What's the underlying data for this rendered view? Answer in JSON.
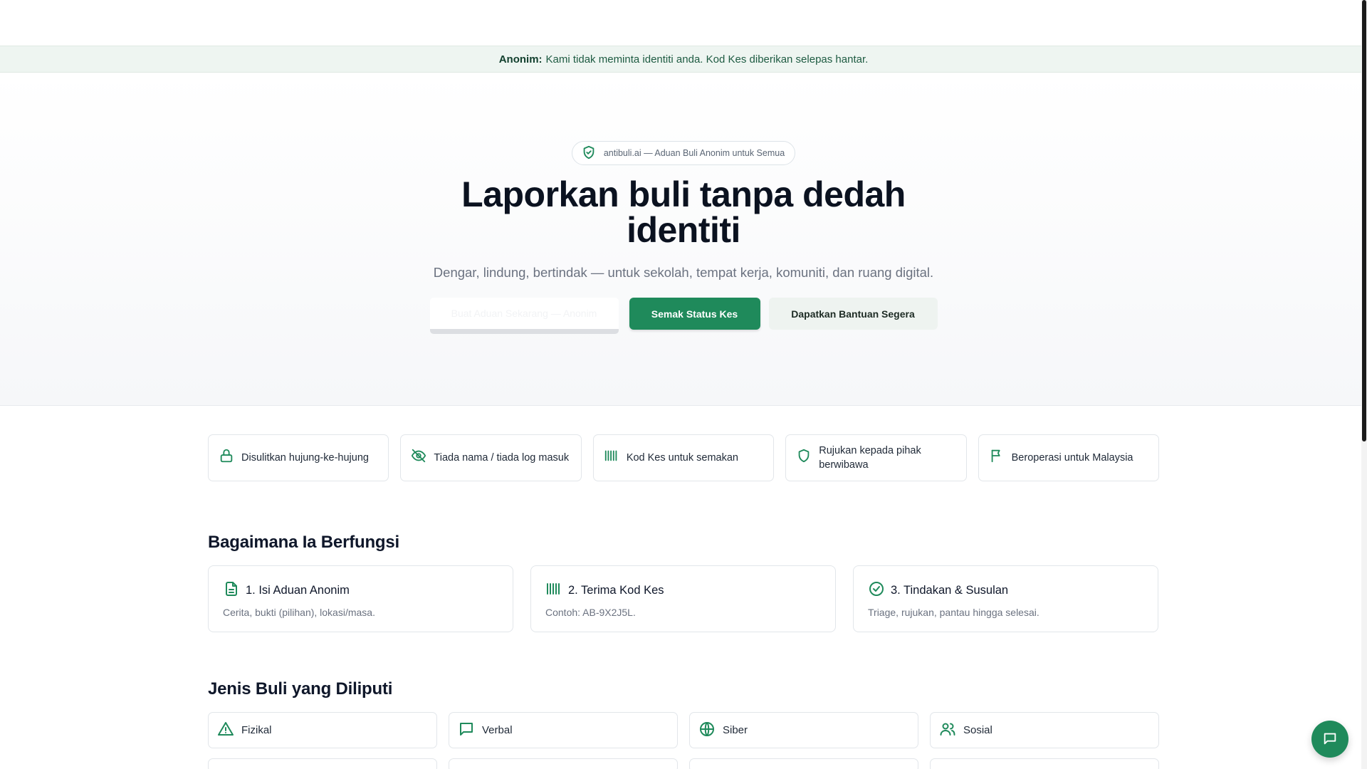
{
  "notice": {
    "label": "Anonim:",
    "text": "Kami tidak meminta identiti anda. Kod Kes diberikan selepas hantar."
  },
  "hero": {
    "badge": "antibuli.ai — Aduan Buli Anonim untuk Semua",
    "title": "Laporkan buli tanpa dedah identiti",
    "subtitle": "Dengar, lindung, bertindak — untuk sekolah, tempat kerja, komuniti, dan ruang digital.",
    "cta_ghost": "Buat Aduan Sekarang — Anonim",
    "cta_primary": "Semak Status Kes",
    "cta_secondary": "Dapatkan Bantuan Segera"
  },
  "features": [
    {
      "icon": "lock-icon",
      "label": "Disulitkan hujung-ke-hujung"
    },
    {
      "icon": "eye-off-icon",
      "label": "Tiada nama / tiada log masuk"
    },
    {
      "icon": "barcode-icon",
      "label": "Kod Kes untuk semakan"
    },
    {
      "icon": "shield-icon",
      "label": "Rujukan kepada pihak berwibawa"
    },
    {
      "icon": "flag-icon",
      "label": "Beroperasi untuk Malaysia"
    }
  ],
  "how": {
    "title": "Bagaimana Ia Berfungsi",
    "steps": [
      {
        "icon": "document-icon",
        "title": "1. Isi Aduan Anonim",
        "desc": "Cerita, bukti (pilihan), lokasi/masa."
      },
      {
        "icon": "barcode-icon",
        "title": "2. Terima Kod Kes",
        "desc": "Contoh: AB-9X2J5L."
      },
      {
        "icon": "check-circle-icon",
        "title": "3. Tindakan & Susulan",
        "desc": "Triage, rujukan, pantau hingga selesai."
      }
    ]
  },
  "types": {
    "title": "Jenis Buli yang Diliputi",
    "items": [
      {
        "icon": "warning-icon",
        "label": "Fizikal"
      },
      {
        "icon": "chat-bubble-icon",
        "label": "Verbal"
      },
      {
        "icon": "globe-icon",
        "label": "Siber"
      },
      {
        "icon": "users-icon",
        "label": "Sosial"
      }
    ]
  },
  "colors": {
    "accent": "#1f8a5b",
    "notice_bg": "#eef5f1",
    "soft_button": "#eef3f0"
  }
}
